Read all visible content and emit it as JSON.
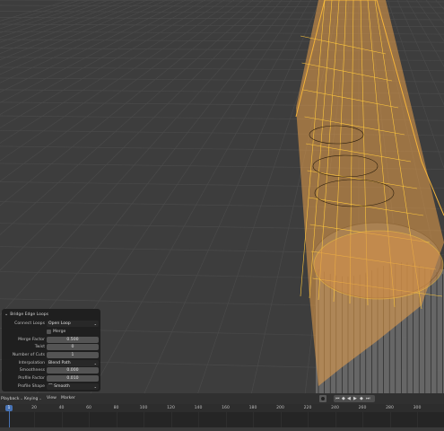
{
  "operator_panel": {
    "title": "Bridge Edge Loops",
    "connect_loops": {
      "label": "Connect Loops",
      "value": "Open Loop"
    },
    "merge": {
      "label": "Merge",
      "checked": false
    },
    "merge_factor": {
      "label": "Merge Factor",
      "value": "0.500"
    },
    "twist": {
      "label": "Twist",
      "value": "0"
    },
    "number_of_cuts": {
      "label": "Number of Cuts",
      "value": "1"
    },
    "interpolation": {
      "label": "Interpolation",
      "value": "Blend Path"
    },
    "smoothness": {
      "label": "Smoothness",
      "value": "0.000"
    },
    "profile_factor": {
      "label": "Profile Factor",
      "value": "0.010"
    },
    "profile_shape": {
      "label": "Profile Shape",
      "value": "Smooth"
    }
  },
  "timeline_header": {
    "playback": "Playback",
    "keying": "Keying",
    "view": "View",
    "marker": "Marker"
  },
  "timeline": {
    "current_frame": "1",
    "ticks": [
      "20",
      "40",
      "60",
      "80",
      "100",
      "120",
      "140",
      "160",
      "180",
      "200",
      "220",
      "240",
      "260",
      "280",
      "300",
      "320"
    ]
  },
  "colors": {
    "viewport_bg": "#3d3d3d",
    "selection": "#f5a623",
    "accent": "#4772b3"
  }
}
